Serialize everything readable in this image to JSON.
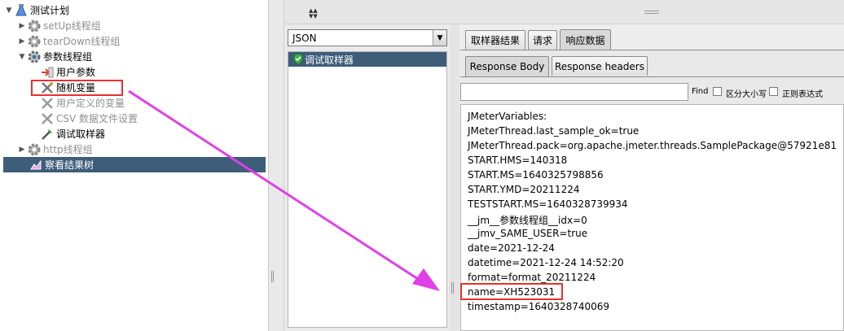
{
  "tree": {
    "items": [
      {
        "label": "测试计划",
        "toggle": "▼",
        "icon": "test-plan-icon",
        "disabled": false,
        "selected": false
      },
      {
        "label": "setUp线程组",
        "toggle": "▶",
        "icon": "gear-icon",
        "disabled": true,
        "selected": false
      },
      {
        "label": "tearDown线程组",
        "toggle": "▶",
        "icon": "gear-icon",
        "disabled": true,
        "selected": false
      },
      {
        "label": "参数线程组",
        "toggle": "▼",
        "icon": "gear-icon",
        "disabled": false,
        "selected": false
      },
      {
        "label": "用户参数",
        "toggle": "",
        "icon": "pre-processor-icon",
        "disabled": false,
        "selected": false
      },
      {
        "label": "随机变量",
        "toggle": "",
        "icon": "config-element-icon",
        "disabled": false,
        "selected": false
      },
      {
        "label": "用户定义的变量",
        "toggle": "",
        "icon": "config-element-icon",
        "disabled": true,
        "selected": false
      },
      {
        "label": "CSV 数据文件设置",
        "toggle": "",
        "icon": "config-element-icon",
        "disabled": true,
        "selected": false
      },
      {
        "label": "调试取样器",
        "toggle": "",
        "icon": "sampler-icon",
        "disabled": false,
        "selected": false
      },
      {
        "label": "http线程组",
        "toggle": "▶",
        "icon": "gear-icon",
        "disabled": true,
        "selected": false
      },
      {
        "label": "察看结果树",
        "toggle": "",
        "icon": "listener-icon",
        "disabled": false,
        "selected": true
      }
    ]
  },
  "results": {
    "renderer": "JSON",
    "item_label": "调试取样器"
  },
  "tabs": {
    "main": [
      "取样器结果",
      "请求",
      "响应数据"
    ],
    "active_main": "响应数据",
    "sub": [
      "Response Body",
      "Response headers"
    ],
    "active_sub": "Response Body"
  },
  "find": {
    "value": "",
    "find_label": "Find",
    "case_label": "区分大小写",
    "regex_label": "正则表达式"
  },
  "response_lines": [
    "JMeterVariables:",
    "JMeterThread.last_sample_ok=true",
    "JMeterThread.pack=org.apache.jmeter.threads.SamplePackage@57921e81",
    "START.HMS=140318",
    "START.MS=1640325798856",
    "START.YMD=20211224",
    "TESTSTART.MS=1640328739934",
    "__jm__参数线程组__idx=0",
    "__jmv_SAME_USER=true",
    "date=2021-12-24",
    "datetime=2021-12-24 14:52:20",
    "format=format_20211224",
    "name=XH523031",
    "timestamp=1640328740069"
  ],
  "colors": {
    "selection": "#3d5d79",
    "annotation_red": "#e8302f",
    "annotation_arrow": "#e040e8"
  }
}
